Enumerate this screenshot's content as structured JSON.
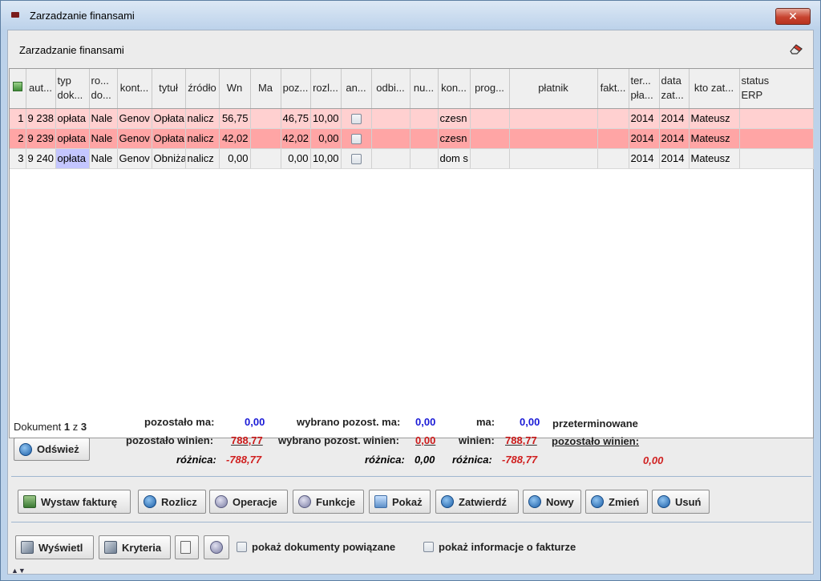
{
  "window": {
    "title": "Zarzadzanie finansami",
    "close_label": "✕"
  },
  "panel": {
    "title": "Zarzadzanie finansami"
  },
  "table": {
    "headers": [
      {
        "l1": "",
        "l2": ""
      },
      {
        "l1": "aut...",
        "l2": ""
      },
      {
        "l1": "typ",
        "l2": "dok..."
      },
      {
        "l1": "ro...",
        "l2": "do..."
      },
      {
        "l1": "kont...",
        "l2": ""
      },
      {
        "l1": "tytuł",
        "l2": ""
      },
      {
        "l1": "źródło",
        "l2": ""
      },
      {
        "l1": "Wn",
        "l2": ""
      },
      {
        "l1": "Ma",
        "l2": ""
      },
      {
        "l1": "poz...",
        "l2": ""
      },
      {
        "l1": "rozl...",
        "l2": ""
      },
      {
        "l1": "an...",
        "l2": ""
      },
      {
        "l1": "odbi...",
        "l2": ""
      },
      {
        "l1": "nu...",
        "l2": ""
      },
      {
        "l1": "kon...",
        "l2": ""
      },
      {
        "l1": "prog...",
        "l2": ""
      },
      {
        "l1": "płatnik",
        "l2": ""
      },
      {
        "l1": "fakt...",
        "l2": ""
      },
      {
        "l1": "ter...",
        "l2": "pła..."
      },
      {
        "l1": "data",
        "l2": "zat..."
      },
      {
        "l1": "kto zat...",
        "l2": ""
      },
      {
        "l1": "status",
        "l2": "ERP"
      }
    ],
    "rows": [
      [
        "1",
        "9 238",
        "opłata",
        "Nale",
        "Genov",
        "Opłata",
        "nalicz",
        "56,75",
        "",
        "46,75",
        "10,00",
        "",
        "",
        "",
        "czesn",
        "",
        "",
        "",
        "2014",
        "2014",
        "Mateusz",
        ""
      ],
      [
        "2",
        "9 239",
        "opłata",
        "Nale",
        "Genov",
        "Opłata",
        "nalicz",
        "42,02",
        "",
        "42,02",
        "0,00",
        "",
        "",
        "",
        "czesn",
        "",
        "",
        "",
        "2014",
        "2014",
        "Mateusz",
        ""
      ],
      [
        "3",
        "9 240",
        "opłata",
        "Nale",
        "Genov",
        "Obniża",
        "nalicz",
        "0,00",
        "",
        "0,00",
        "10,00",
        "",
        "",
        "",
        "dom s",
        "",
        "",
        "",
        "2014",
        "2014",
        "Mateusz",
        ""
      ]
    ]
  },
  "summary": {
    "doc_prefix": "Dokument ",
    "doc_current": "1",
    "doc_mid": " z ",
    "doc_total": "3",
    "refresh_label": "Odśwież",
    "left": {
      "ma_label": "pozostało ma:",
      "ma_value": "0,00",
      "winien_label": "pozostało winien:",
      "winien_value": "788,77",
      "diff_label": "różnica:",
      "diff_value": "-788,77"
    },
    "middle": {
      "ma_label": "wybrano pozost. ma:",
      "ma_value": "0,00",
      "winien_label": "wybrano pozost. winien:",
      "winien_value": "0,00",
      "diff_label": "różnica:",
      "diff_value": "0,00"
    },
    "right": {
      "ma_label": "ma:",
      "ma_value": "0,00",
      "winien_label": "winien:",
      "winien_value": "788,77",
      "diff_label": "różnica:",
      "diff_value": "-788,77"
    },
    "overdue": {
      "label1": "przeterminowane",
      "label2": "pozostało winien:",
      "value": "0,00"
    }
  },
  "toolbar": {
    "wystaw": "Wystaw fakturę",
    "rozlicz": "Rozlicz",
    "operacje": "Operacje",
    "funkcje": "Funkcje",
    "pokaz": "Pokaż",
    "zatwierdz": "Zatwierdź",
    "nowy": "Nowy",
    "zmien": "Zmień",
    "usun": "Usuń"
  },
  "bottom": {
    "wyswietl": "Wyświetl",
    "kryteria": "Kryteria",
    "cb_related": "pokaż dokumenty powiązane",
    "cb_invoice": "pokaż informacje o fakturze"
  }
}
